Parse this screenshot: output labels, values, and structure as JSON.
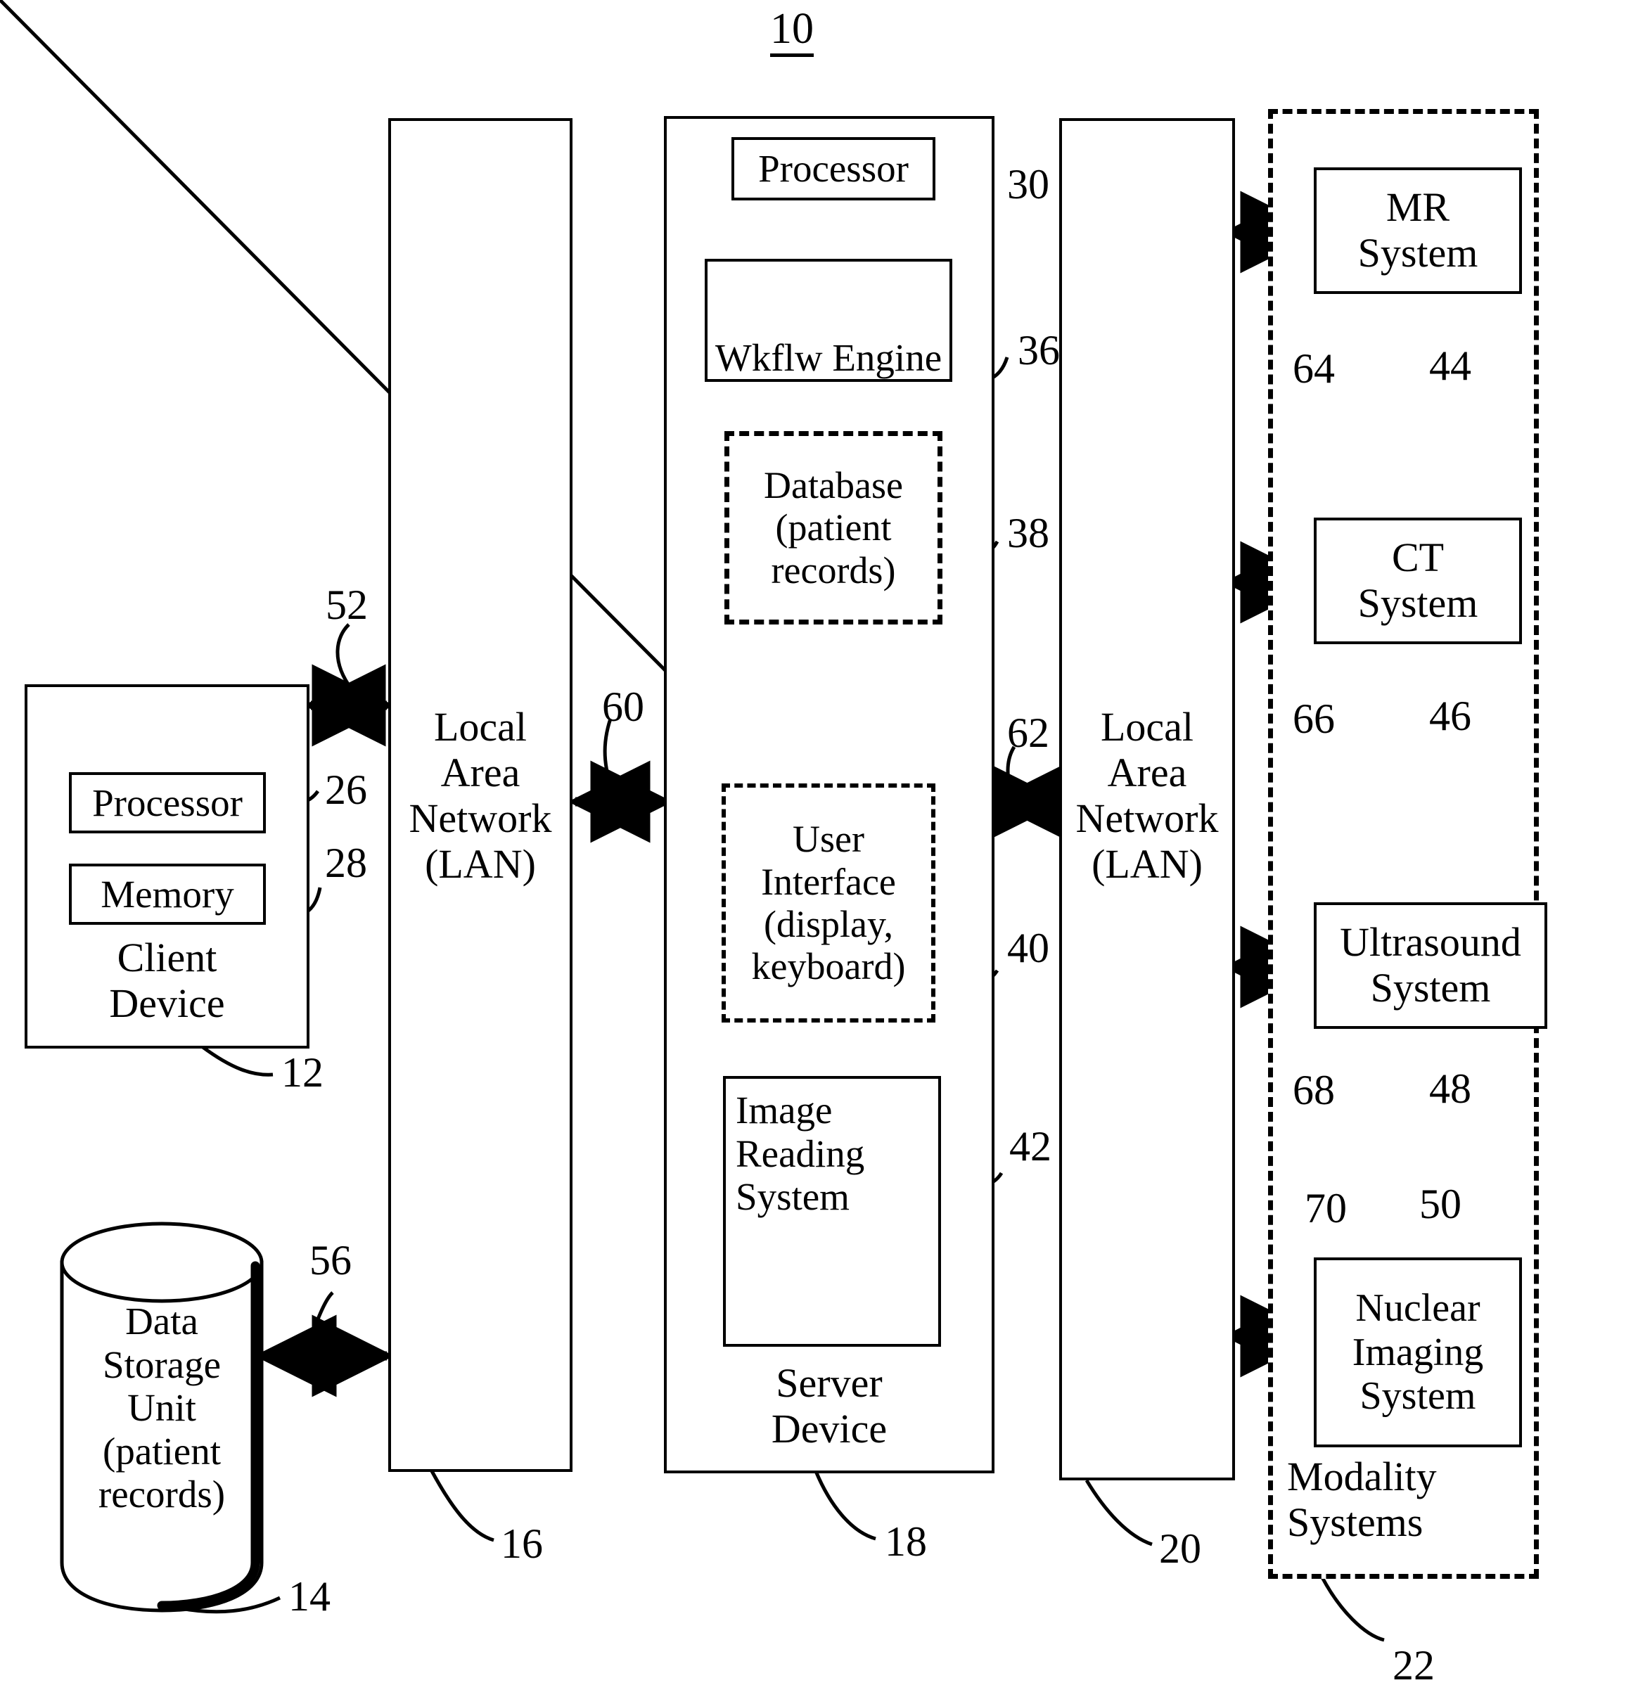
{
  "figure": {
    "number": "10"
  },
  "client_device": {
    "title": "Client\nDevice",
    "ref": "12",
    "processor": {
      "label": "Processor",
      "ref": "26"
    },
    "memory": {
      "label": "Memory",
      "ref": "28"
    },
    "link_ref": "52"
  },
  "data_storage": {
    "label": "Data\nStorage\nUnit\n(patient\nrecords)",
    "ref": "14",
    "link_ref": "56"
  },
  "lan_left": {
    "label": "Local\nArea\nNetwork\n(LAN)",
    "ref": "16",
    "link_ref": "60"
  },
  "server_device": {
    "title": "Server\nDevice",
    "ref": "18",
    "processor": {
      "label": "Processor",
      "ref": "30"
    },
    "workflow_engine": {
      "label": "Wkflw Engine",
      "ref": "36"
    },
    "database": {
      "label": "Database\n(patient\nrecords)",
      "ref": "38"
    },
    "user_interface": {
      "label": "User\nInterface\n(display,\nkeyboard)",
      "ref": "40"
    },
    "image_reading_system": {
      "label": "Image\nReading\nSystem",
      "ref": "42"
    },
    "link_ref": "62"
  },
  "lan_right": {
    "label": "Local\nArea\nNetwork\n(LAN)",
    "ref": "20"
  },
  "modality_systems": {
    "title": "Modality\nSystems",
    "ref": "22",
    "items": [
      {
        "label": "MR\nSystem",
        "ref": "44",
        "link_ref": "64"
      },
      {
        "label": "CT\nSystem",
        "ref": "46",
        "link_ref": "66"
      },
      {
        "label": "Ultrasound\nSystem",
        "ref": "48",
        "link_ref": "68"
      },
      {
        "label": "Nuclear\nImaging\nSystem",
        "ref": "50",
        "link_ref": "70"
      }
    ]
  }
}
